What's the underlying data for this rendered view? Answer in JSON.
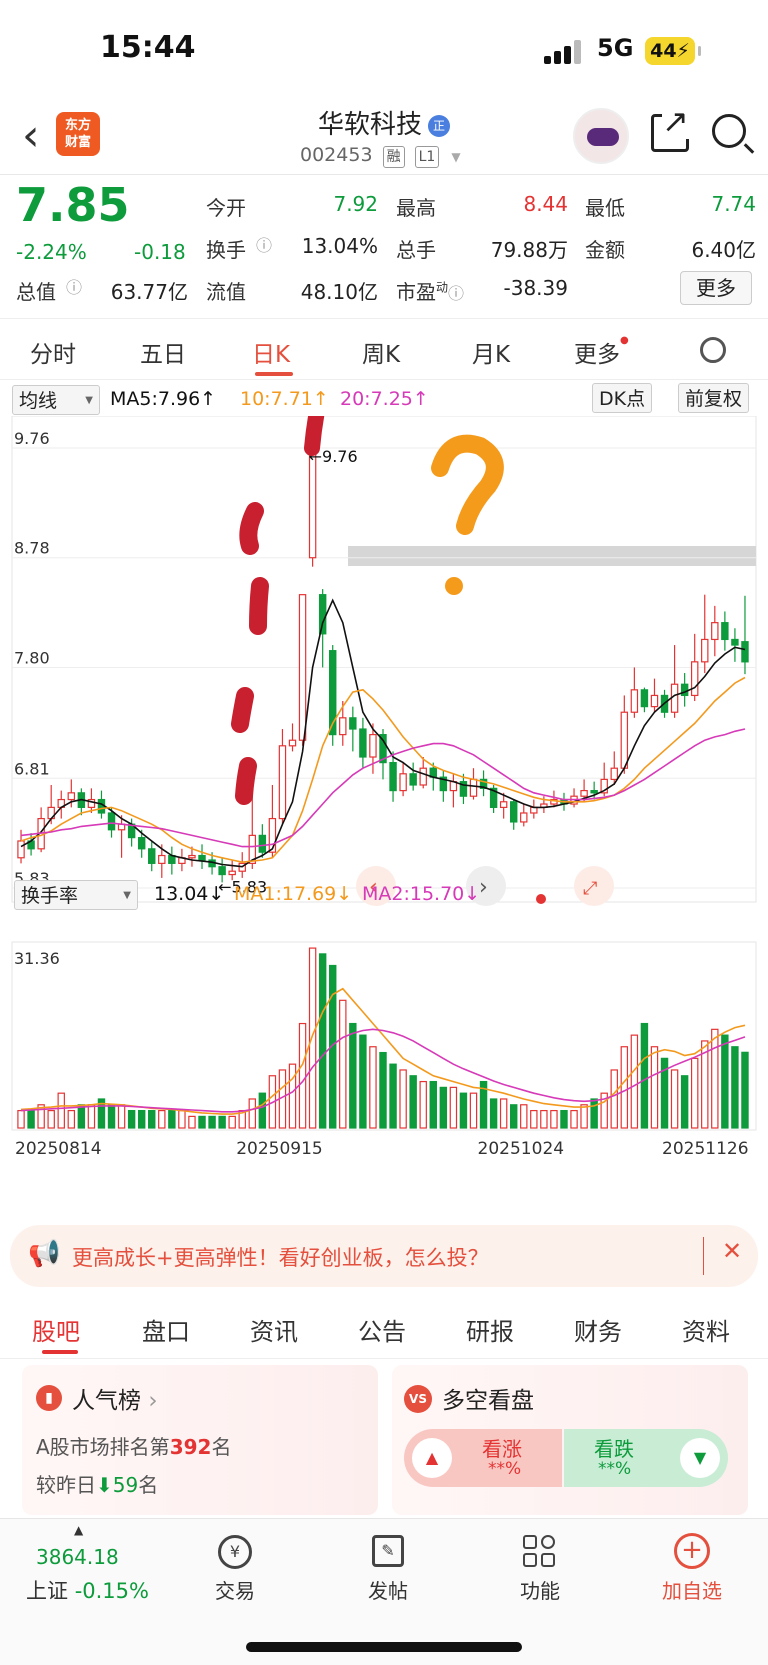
{
  "status_bar": {
    "time": "15:44",
    "network": "5G",
    "battery": "44"
  },
  "header": {
    "logo_line1": "东方",
    "logo_line2": "财富",
    "stock_name": "华软科技",
    "name_badge": "正",
    "stock_code": "002453",
    "tag_margin": "融",
    "tag_level": "L1"
  },
  "quote": {
    "price": "7.85",
    "change_pct": "-2.24%",
    "change_abs": "-0.18",
    "open_label": "今开",
    "open": "7.92",
    "high_label": "最高",
    "high": "8.44",
    "low_label": "最低",
    "low": "7.74",
    "turnover_label": "换手",
    "turnover": "13.04%",
    "volume_label": "总手",
    "volume": "79.88万",
    "amount_label": "金额",
    "amount": "6.40亿",
    "mktcap_label": "总值",
    "mktcap": "63.77亿",
    "float_label": "流值",
    "float": "48.10亿",
    "pe_label": "市盈",
    "pe_sup": "动",
    "pe": "-38.39",
    "more_label": "更多"
  },
  "k_tabs": [
    "分时",
    "五日",
    "日K",
    "周K",
    "月K",
    "更多"
  ],
  "k_tab_active": 2,
  "chart_controls": {
    "ma_select": "均线",
    "ma5": "MA5:7.96↑",
    "ma10": "10:7.71↑",
    "ma20": "20:7.25↑",
    "dk_button": "DK点",
    "adjust_button": "前复权",
    "vol_select": "换手率",
    "vol_value": "13.04↓",
    "vol_ma1": "MA1:17.69↓",
    "vol_ma2": "MA2:15.70↓"
  },
  "chart_data": {
    "type": "candlestick",
    "price_axis_ticks": [
      "9.76",
      "8.78",
      "7.80",
      "6.81",
      "5.83"
    ],
    "max_annotation": "←9.76",
    "min_annotation": "←5.83",
    "volume_axis_max": "31.36",
    "x_labels": [
      "20250814",
      "20250915",
      "20251024",
      "20251126"
    ],
    "ylim": [
      5.83,
      9.76
    ],
    "candles": [
      [
        6.1,
        6.25,
        6.35,
        6.05
      ],
      [
        6.25,
        6.18,
        6.32,
        6.12
      ],
      [
        6.18,
        6.45,
        6.55,
        6.15
      ],
      [
        6.45,
        6.55,
        6.75,
        6.4
      ],
      [
        6.55,
        6.62,
        6.7,
        6.45
      ],
      [
        6.62,
        6.68,
        6.8,
        6.55
      ],
      [
        6.68,
        6.55,
        6.72,
        6.48
      ],
      [
        6.55,
        6.62,
        6.72,
        6.5
      ],
      [
        6.62,
        6.5,
        6.7,
        6.45
      ],
      [
        6.5,
        6.35,
        6.55,
        6.28
      ],
      [
        6.35,
        6.4,
        6.48,
        6.1
      ],
      [
        6.4,
        6.28,
        6.45,
        6.2
      ],
      [
        6.28,
        6.18,
        6.35,
        6.1
      ],
      [
        6.18,
        6.05,
        6.25,
        5.98
      ],
      [
        6.05,
        6.12,
        6.22,
        5.92
      ],
      [
        6.12,
        6.05,
        6.2,
        5.95
      ],
      [
        6.05,
        6.1,
        6.18,
        5.98
      ],
      [
        6.1,
        6.12,
        6.2,
        6.02
      ],
      [
        6.12,
        6.08,
        6.22,
        6.0
      ],
      [
        6.08,
        6.02,
        6.15,
        5.95
      ],
      [
        6.02,
        5.95,
        6.1,
        5.88
      ],
      [
        5.95,
        5.98,
        6.08,
        5.9
      ],
      [
        5.98,
        6.05,
        6.15,
        5.92
      ],
      [
        6.05,
        6.3,
        6.9,
        6.0
      ],
      [
        6.3,
        6.15,
        6.4,
        6.1
      ],
      [
        6.15,
        6.45,
        6.75,
        6.1
      ],
      [
        6.45,
        7.1,
        7.25,
        6.4
      ],
      [
        7.1,
        7.15,
        7.3,
        7.05
      ],
      [
        7.15,
        8.45,
        8.45,
        7.1
      ],
      [
        8.78,
        9.76,
        9.76,
        8.7
      ],
      [
        8.45,
        8.1,
        8.5,
        7.8
      ],
      [
        7.95,
        7.2,
        8.0,
        7.1
      ],
      [
        7.2,
        7.35,
        7.5,
        7.1
      ],
      [
        7.35,
        7.25,
        7.45,
        7.05
      ],
      [
        7.25,
        7.0,
        7.35,
        6.9
      ],
      [
        7.0,
        7.2,
        7.3,
        6.85
      ],
      [
        7.2,
        6.95,
        7.25,
        6.8
      ],
      [
        6.95,
        6.7,
        7.05,
        6.6
      ],
      [
        6.7,
        6.85,
        6.95,
        6.65
      ],
      [
        6.85,
        6.75,
        6.95,
        6.7
      ],
      [
        6.75,
        6.9,
        7.0,
        6.72
      ],
      [
        6.9,
        6.82,
        6.95,
        6.7
      ],
      [
        6.82,
        6.7,
        6.88,
        6.6
      ],
      [
        6.7,
        6.78,
        6.85,
        6.55
      ],
      [
        6.78,
        6.65,
        6.85,
        6.58
      ],
      [
        6.65,
        6.8,
        6.9,
        6.62
      ],
      [
        6.8,
        6.72,
        6.88,
        6.65
      ],
      [
        6.72,
        6.55,
        6.75,
        6.5
      ],
      [
        6.55,
        6.6,
        6.68,
        6.45
      ],
      [
        6.6,
        6.42,
        6.62,
        6.35
      ],
      [
        6.42,
        6.5,
        6.58,
        6.38
      ],
      [
        6.5,
        6.55,
        6.62,
        6.45
      ],
      [
        6.55,
        6.58,
        6.65,
        6.5
      ],
      [
        6.58,
        6.62,
        6.7,
        6.55
      ],
      [
        6.62,
        6.58,
        6.68,
        6.52
      ],
      [
        6.58,
        6.65,
        6.72,
        6.55
      ],
      [
        6.65,
        6.7,
        6.8,
        6.6
      ],
      [
        6.7,
        6.68,
        6.78,
        6.62
      ],
      [
        6.68,
        6.8,
        6.95,
        6.65
      ],
      [
        6.8,
        6.9,
        7.05,
        6.75
      ],
      [
        6.9,
        7.4,
        7.55,
        6.85
      ],
      [
        7.4,
        7.6,
        7.8,
        7.35
      ],
      [
        7.6,
        7.45,
        7.62,
        7.4
      ],
      [
        7.45,
        7.55,
        7.7,
        7.4
      ],
      [
        7.55,
        7.4,
        7.6,
        7.35
      ],
      [
        7.4,
        7.65,
        8.0,
        7.35
      ],
      [
        7.65,
        7.55,
        7.75,
        7.45
      ],
      [
        7.55,
        7.85,
        8.1,
        7.5
      ],
      [
        7.85,
        8.05,
        8.45,
        7.75
      ],
      [
        8.05,
        8.2,
        8.35,
        7.9
      ],
      [
        8.2,
        8.05,
        8.3,
        7.95
      ],
      [
        8.05,
        8.0,
        8.15,
        7.85
      ],
      [
        8.03,
        7.85,
        8.44,
        7.74
      ]
    ],
    "ma5": [
      6.2,
      6.25,
      6.33,
      6.45,
      6.55,
      6.6,
      6.62,
      6.6,
      6.58,
      6.52,
      6.45,
      6.4,
      6.32,
      6.25,
      6.18,
      6.12,
      6.1,
      6.08,
      6.07,
      6.06,
      6.04,
      6.03,
      6.02,
      6.08,
      6.12,
      6.18,
      6.4,
      6.6,
      7.05,
      7.8,
      8.2,
      8.4,
      8.2,
      7.8,
      7.4,
      7.25,
      7.15,
      7.0,
      6.95,
      6.88,
      6.85,
      6.82,
      6.8,
      6.78,
      6.75,
      6.74,
      6.73,
      6.7,
      6.66,
      6.62,
      6.58,
      6.55,
      6.55,
      6.56,
      6.58,
      6.6,
      6.63,
      6.66,
      6.7,
      6.76,
      6.9,
      7.1,
      7.28,
      7.4,
      7.48,
      7.55,
      7.58,
      7.62,
      7.72,
      7.84,
      7.92,
      7.98,
      7.96
    ],
    "ma10": [
      6.25,
      6.28,
      6.3,
      6.34,
      6.4,
      6.45,
      6.5,
      6.52,
      6.54,
      6.55,
      6.52,
      6.48,
      6.44,
      6.4,
      6.35,
      6.28,
      6.22,
      6.18,
      6.15,
      6.12,
      6.1,
      6.08,
      6.06,
      6.07,
      6.08,
      6.1,
      6.2,
      6.3,
      6.52,
      6.8,
      7.1,
      7.3,
      7.45,
      7.58,
      7.6,
      7.52,
      7.42,
      7.3,
      7.18,
      7.08,
      6.98,
      6.92,
      6.88,
      6.85,
      6.82,
      6.8,
      6.78,
      6.76,
      6.73,
      6.7,
      6.67,
      6.64,
      6.62,
      6.61,
      6.6,
      6.6,
      6.6,
      6.61,
      6.63,
      6.66,
      6.72,
      6.8,
      6.9,
      6.98,
      7.06,
      7.14,
      7.22,
      7.3,
      7.4,
      7.5,
      7.58,
      7.66,
      7.71
    ],
    "ma20": [
      6.3,
      6.31,
      6.32,
      6.33,
      6.35,
      6.36,
      6.38,
      6.39,
      6.4,
      6.41,
      6.4,
      6.39,
      6.38,
      6.37,
      6.36,
      6.34,
      6.32,
      6.3,
      6.28,
      6.26,
      6.24,
      6.22,
      6.2,
      6.2,
      6.21,
      6.22,
      6.26,
      6.3,
      6.38,
      6.48,
      6.58,
      6.68,
      6.76,
      6.84,
      6.9,
      6.94,
      6.98,
      7.02,
      7.05,
      7.08,
      7.1,
      7.12,
      7.12,
      7.1,
      7.06,
      7.02,
      6.96,
      6.9,
      6.84,
      6.78,
      6.72,
      6.68,
      6.66,
      6.64,
      6.62,
      6.62,
      6.62,
      6.63,
      6.64,
      6.66,
      6.7,
      6.75,
      6.8,
      6.86,
      6.92,
      6.98,
      7.04,
      7.1,
      7.15,
      7.18,
      7.2,
      7.23,
      7.25
    ],
    "volume": [
      3,
      3,
      4,
      3,
      6,
      3,
      4,
      4,
      5,
      4,
      4,
      3,
      3,
      3,
      3,
      3,
      3,
      2,
      2,
      2,
      2,
      2,
      3,
      5,
      6,
      9,
      10,
      11,
      18,
      31,
      30,
      28,
      22,
      18,
      16,
      14,
      13,
      11,
      10,
      9,
      8,
      8,
      7,
      7,
      6,
      6,
      8,
      5,
      5,
      4,
      4,
      3,
      3,
      3,
      3,
      3,
      4,
      5,
      6,
      10,
      14,
      16,
      18,
      14,
      12,
      10,
      9,
      12,
      15,
      17,
      16,
      14,
      13.04
    ],
    "volume_ma1": [
      3.2,
      3.3,
      3.5,
      3.6,
      3.8,
      3.8,
      3.9,
      4.0,
      4.2,
      4.1,
      4.0,
      3.8,
      3.6,
      3.4,
      3.3,
      3.2,
      3.0,
      2.8,
      2.6,
      2.5,
      2.4,
      2.4,
      2.6,
      3.2,
      4.0,
      5.5,
      7.0,
      8.5,
      11,
      16,
      20,
      23,
      24,
      22,
      20,
      18,
      16,
      14,
      12,
      11,
      10,
      9,
      8.5,
      8,
      7.5,
      7,
      6.8,
      6.4,
      6,
      5.5,
      5,
      4.6,
      4.2,
      4,
      3.8,
      3.6,
      3.6,
      3.8,
      4.5,
      6,
      8,
      10,
      12,
      13,
      13.5,
      13.2,
      12.5,
      12.8,
      14,
      15.5,
      16.5,
      17.3,
      17.69
    ],
    "volume_ma2": [
      3.0,
      3.1,
      3.2,
      3.3,
      3.4,
      3.5,
      3.6,
      3.7,
      3.8,
      3.8,
      3.8,
      3.7,
      3.6,
      3.5,
      3.4,
      3.3,
      3.2,
      3.1,
      3.0,
      2.9,
      2.8,
      2.8,
      2.9,
      3.2,
      3.6,
      4.4,
      5.3,
      6.2,
      8.0,
      10.5,
      12.5,
      14.3,
      15.6,
      16.3,
      16.8,
      17.0,
      16.8,
      16.4,
      15.8,
      15.0,
      14.0,
      13.0,
      12.0,
      11.0,
      10.2,
      9.5,
      8.8,
      8.1,
      7.5,
      7.0,
      6.5,
      6.0,
      5.6,
      5.2,
      4.9,
      4.7,
      4.6,
      4.7,
      5.0,
      5.6,
      6.4,
      7.3,
      8.3,
      9.2,
      10.0,
      10.8,
      11.5,
      12.2,
      13.0,
      13.8,
      14.5,
      15.1,
      15.7
    ]
  },
  "ad_banner": {
    "text": "更高成长+更高弹性！看好创业板，怎么投？"
  },
  "bottom_tabs": [
    "股吧",
    "盘口",
    "资讯",
    "公告",
    "研报",
    "财务",
    "资料"
  ],
  "popularity": {
    "title": "人气榜",
    "rank_prefix": "A股市场排名第",
    "rank": "392",
    "rank_suffix": "名",
    "change_prefix": "较昨日",
    "change": "59",
    "change_suffix": "名"
  },
  "sentiment": {
    "title": "多空看盘",
    "up_label": "看涨",
    "up_value": "**%",
    "down_label": "看跌",
    "down_value": "**%"
  },
  "bottom_nav": {
    "index_value": "3864.18",
    "index_name": "上证",
    "index_change": "-0.15%",
    "trade": "交易",
    "post": "发帖",
    "func": "功能",
    "add": "加自选"
  },
  "colors": {
    "up": "#e43333",
    "down": "#0d9b3c",
    "ma5": "#111111",
    "ma10": "#f39a1e",
    "ma20": "#d63ab8",
    "accent": "#e4503d"
  }
}
